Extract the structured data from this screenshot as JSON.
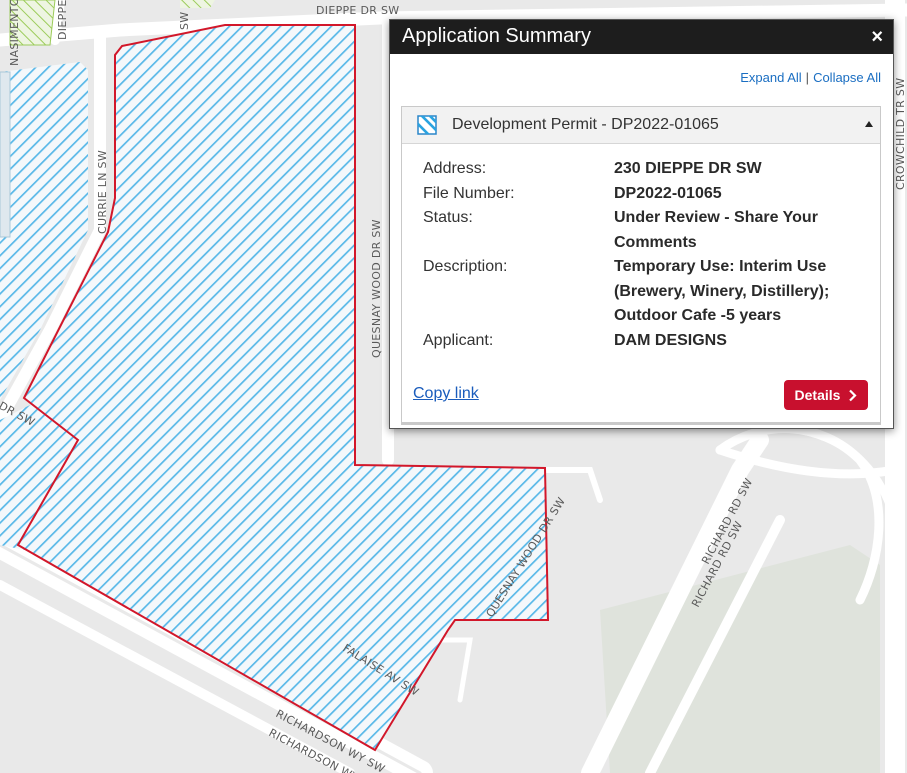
{
  "map": {
    "streets": {
      "dieppe_top": "DIEPPE DR SW",
      "dieppe_vertical": "DIEPPE",
      "crowchild": "CROWCHILD TR SW",
      "currie": "CURRIE LN SW",
      "quesnay_vertical": "QUESNAY WOOD DR SW",
      "quesnay_diagonal": "QUESNAY WOOD DR SW",
      "richardson_rd_1": "RICHARD RD SW",
      "richardson_rd_2": "RICHARD RD SW",
      "falaise": "FALAISE AV SW",
      "richardson_wy_1": "RICHARDSON WY SW",
      "richardson_wy_2": "RICHARDSON WY SW",
      "nasimento": "NASIMENTO",
      "dr_sw_left": "DR SW",
      "sw_top": "SW"
    },
    "colors": {
      "background": "#e9e9e9",
      "road": "#ffffff",
      "hatch": "#58b8e8",
      "hatch_green": "#9ccc5a",
      "boundary": "#d2172a",
      "green_area": "#dfe3dc"
    }
  },
  "popup": {
    "title": "Application Summary",
    "close": "×",
    "expand_all": "Expand All",
    "separator": "|",
    "collapse_all": "Collapse All",
    "permit_title": "Development Permit - DP2022-01065",
    "fields": [
      {
        "label": "Address:",
        "value": "230 DIEPPE DR SW"
      },
      {
        "label": "File Number:",
        "value": "DP2022-01065"
      },
      {
        "label": "Status:",
        "value": "Under Review - Share Your Comments"
      },
      {
        "label": "Description:",
        "value": "Temporary Use: Interim Use (Brewery, Winery, Distillery); Outdoor Cafe -5 years"
      },
      {
        "label": "Applicant:",
        "value": "DAM DESIGNS"
      }
    ],
    "copy_link": "Copy link",
    "details": "Details",
    "details_icon": "chevron-right-icon",
    "accent": "#c8102e"
  }
}
